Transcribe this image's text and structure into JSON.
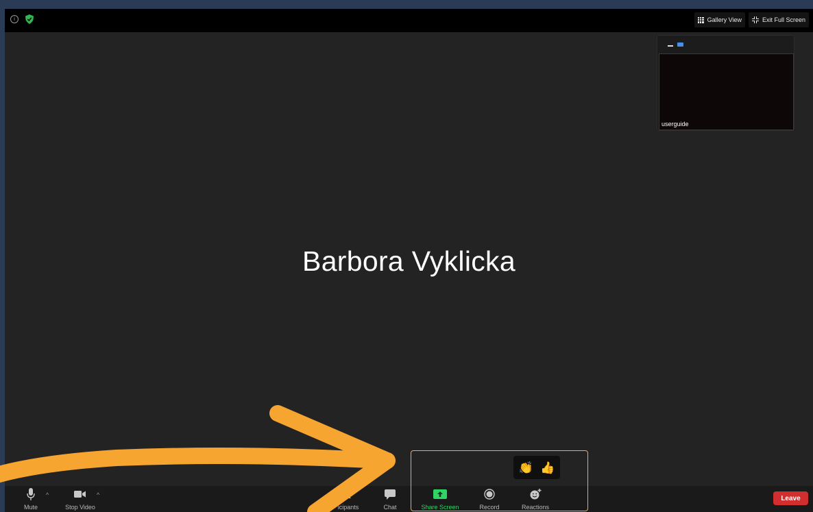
{
  "top_bar": {
    "info_icon": "info-icon",
    "shield_icon": "shield-icon",
    "gallery_view_label": "Gallery View",
    "exit_full_screen_label": "Exit Full Screen"
  },
  "self_view": {
    "name": "userguide"
  },
  "active_speaker": {
    "name": "Barbora Vyklicka"
  },
  "toolbar": {
    "mute_label": "Mute",
    "stop_video_label": "Stop Video",
    "participants_label": "icipants",
    "chat_label": "Chat",
    "share_screen_label": "Share Screen",
    "record_label": "Record",
    "reactions_label": "Reactions",
    "leave_label": "Leave"
  },
  "reactions": {
    "clap": "👏",
    "thumbs_up": "👍"
  },
  "colors": {
    "accent_green": "#2fd464",
    "leave_red": "#d12f2f",
    "annotation_orange": "#f7a531",
    "highlight_border": "#f0b03a"
  }
}
